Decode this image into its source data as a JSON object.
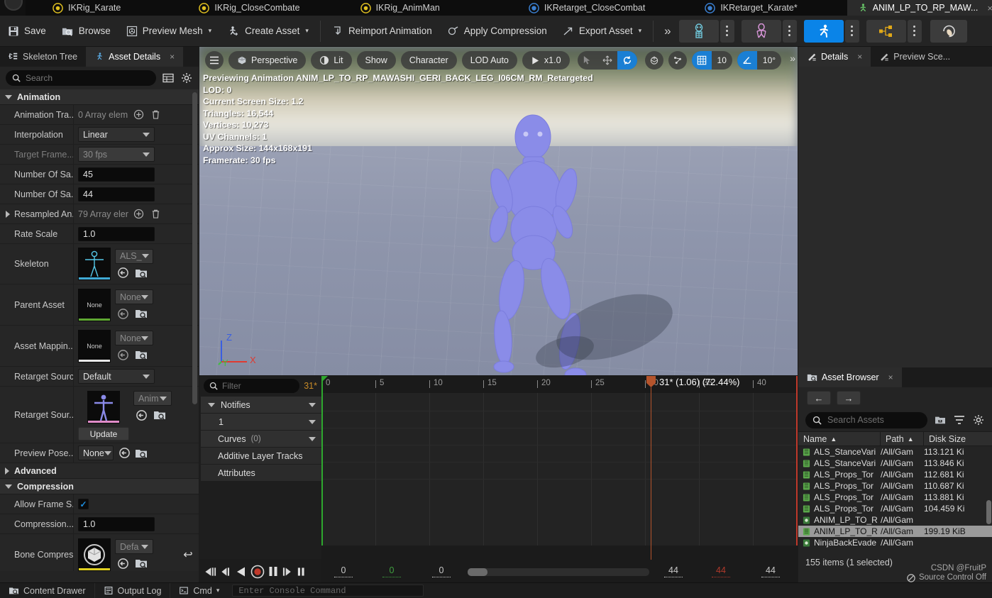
{
  "window": {
    "tabs": [
      {
        "label": "IKRig_Karate",
        "icon": "ikrig-icon",
        "active": false,
        "closable": false
      },
      {
        "label": "IKRig_CloseCombate",
        "icon": "ikrig-icon",
        "active": false,
        "closable": false
      },
      {
        "label": "IKRig_AnimMan",
        "icon": "ikrig-icon",
        "active": false,
        "closable": false
      },
      {
        "label": "IKRetarget_CloseCombat",
        "icon": "ikretarget-icon",
        "active": false,
        "closable": false
      },
      {
        "label": "IKRetarget_Karate*",
        "icon": "ikretarget-icon",
        "active": false,
        "closable": false
      },
      {
        "label": "ANIM_LP_TO_RP_MAW...",
        "icon": "animsequence-icon",
        "active": true,
        "closable": true,
        "close_label": "×"
      }
    ]
  },
  "toolbar": {
    "buttons": [
      {
        "label": "Save",
        "icon": "save-icon",
        "caret": false
      },
      {
        "label": "Browse",
        "icon": "browse-icon",
        "caret": false
      },
      {
        "label": "Preview Mesh",
        "icon": "preview-mesh-icon",
        "caret": true
      },
      {
        "label": "Create Asset",
        "icon": "create-asset-icon",
        "caret": true
      },
      {
        "label": "Reimport Animation",
        "icon": "reimport-icon",
        "caret": false
      },
      {
        "label": "Apply Compression",
        "icon": "compression-icon",
        "caret": false
      },
      {
        "label": "Export Asset",
        "icon": "export-icon",
        "caret": true
      }
    ],
    "overflow_glyph": "»",
    "caret_glyph": "▾",
    "modes": [
      {
        "name": "skeleton-mode",
        "selected": false
      },
      {
        "name": "mesh-mode",
        "selected": false
      },
      {
        "name": "animation-mode",
        "selected": true
      },
      {
        "name": "graph-mode",
        "selected": false
      },
      {
        "name": "physics-mode",
        "selected": false
      }
    ]
  },
  "left_panel": {
    "tabs": [
      {
        "label": "Skeleton Tree",
        "icon": "skeleton-tree-icon",
        "active": false,
        "closable": false
      },
      {
        "label": "Asset Details",
        "icon": "asset-details-icon",
        "active": true,
        "closable": true
      }
    ],
    "close_glyph": "×",
    "search": {
      "placeholder": "Search",
      "value": ""
    },
    "sections": [
      {
        "title": "Animation",
        "expanded": true
      },
      {
        "title": "Advanced",
        "expanded": false
      },
      {
        "title": "Compression",
        "expanded": true
      }
    ],
    "properties": {
      "animation_track_names": {
        "label": "Animation Tra...",
        "value": "0 Array elem"
      },
      "interpolation": {
        "label": "Interpolation",
        "value": "Linear"
      },
      "target_frame_rate": {
        "label": "Target Frame...",
        "value": "30 fps",
        "disabled": true
      },
      "number_of_samples_1": {
        "label": "Number Of Sa...",
        "value": "45"
      },
      "number_of_samples_2": {
        "label": "Number Of Sa...",
        "value": "44"
      },
      "resampled_anim": {
        "label": "Resampled An...",
        "value": "79 Array eler"
      },
      "rate_scale": {
        "label": "Rate Scale",
        "value": "1.0"
      },
      "skeleton": {
        "label": "Skeleton",
        "value": "ALS_",
        "thumb_caption": "",
        "bar_color": "#3fa9d4"
      },
      "parent_asset": {
        "label": "Parent Asset",
        "value": "None",
        "thumb_caption": "None",
        "bar_color": "#5fa832"
      },
      "asset_mapping": {
        "label": "Asset Mappin...",
        "value": "None",
        "thumb_caption": "None",
        "bar_color": "#e8e8e8"
      },
      "retarget_source": {
        "label": "Retarget Source",
        "value": "Default"
      },
      "retarget_source_asset": {
        "label": "Retarget Sour...",
        "value": "Anim",
        "thumb_caption": "",
        "bar_color": "#e08cc8",
        "button": "Update"
      },
      "preview_pose_asset": {
        "label": "Preview Pose...",
        "value": "None"
      },
      "allow_frame_stripping": {
        "label": "Allow Frame S...",
        "checked": true,
        "check_glyph": "✓"
      },
      "compression_error": {
        "label": "Compression...",
        "value": "1.0"
      },
      "bone_compression": {
        "label": "Bone Compres...",
        "value": "Defa",
        "thumb_caption": "",
        "bar_color": "#e0d020"
      }
    },
    "array_add_glyph": "⊕",
    "revert_glyph": "↩"
  },
  "viewport": {
    "chips": {
      "menu": "≡",
      "perspective": "Perspective",
      "lit": "Lit",
      "show": "Show",
      "character": "Character",
      "lod": "LOD Auto",
      "playrate": "x1.0"
    },
    "grid_snap_value": "10",
    "angle_snap_value": "10°",
    "overflow_glyph": "»",
    "stats": [
      "Previewing Animation ANIM_LP_TO_RP_MAWASHI_GERI_BACK_LEG_I06CM_RM_Retargeted",
      "LOD: 0",
      "Current Screen Size: 1.2",
      "Triangles: 16,544",
      "Vertices: 10,273",
      "UV Channels: 1",
      "Approx Size: 144x168x191",
      "Framerate: 30 fps"
    ],
    "gizmo": {
      "x": "X",
      "y": "Y",
      "z": "Z",
      "x_color": "#e03a30",
      "y_color": "#3fc03f",
      "z_color": "#3a5fe0"
    }
  },
  "timeline": {
    "filter": {
      "placeholder": "Filter",
      "value": ""
    },
    "frame_count_badge": "31*",
    "tracks": [
      {
        "label": "Notifies",
        "expandable": true,
        "count": ""
      },
      {
        "label": "1",
        "expandable": true,
        "count": "",
        "indent": true
      },
      {
        "label": "Curves",
        "expandable": true,
        "count": "(0)"
      },
      {
        "label": "Additive Layer Tracks",
        "expandable": false,
        "count": ""
      },
      {
        "label": "Attributes",
        "expandable": false,
        "count": ""
      }
    ],
    "ruler_ticks": [
      "0",
      "5",
      "10",
      "15",
      "20",
      "25",
      "30",
      "35",
      "40"
    ],
    "playhead_label": "31* (1.06) (72.44%)",
    "transport": [
      {
        "name": "step-to-previous-key-button",
        "glyph": "◀|||"
      },
      {
        "name": "step-backward-button",
        "glyph": "◀|"
      },
      {
        "name": "play-reverse-button",
        "glyph": "◀"
      },
      {
        "name": "record-button",
        "glyph": "●"
      },
      {
        "name": "pause-button",
        "glyph": "▐▌"
      },
      {
        "name": "step-forward-button",
        "glyph": "|▶"
      },
      {
        "name": "loop-button",
        "glyph": "▐▌"
      }
    ],
    "numbers": {
      "start_frame": "0",
      "current_frame": "0",
      "in_frame": "0",
      "out_frame": "44",
      "playback_end": "44",
      "total_frames": "44"
    }
  },
  "right_panel": {
    "tabs": [
      {
        "label": "Details",
        "icon": "details-icon",
        "active": true,
        "closable": true
      },
      {
        "label": "Preview Sce...",
        "icon": "preview-scene-icon",
        "active": false,
        "closable": false
      }
    ],
    "close_glyph": "×"
  },
  "asset_browser": {
    "tab": {
      "label": "Asset Browser",
      "icon": "asset-browser-icon",
      "closable": true,
      "close_glyph": "×"
    },
    "nav": {
      "back": "←",
      "forward": "→"
    },
    "search": {
      "placeholder": "Search Assets",
      "value": ""
    },
    "tool_icons": [
      "save-thumbnail-icon",
      "filter-icon",
      "settings-gear-icon"
    ],
    "columns": [
      {
        "label": "Name",
        "sort": "▲"
      },
      {
        "label": "Path",
        "sort": "▲"
      },
      {
        "label": "Disk Size",
        "sort": ""
      }
    ],
    "rows": [
      {
        "name": "ALS_StanceVari",
        "path": "/All/Gam",
        "size": "113.121 Ki",
        "icon_color": "#5aa84a",
        "selected": false
      },
      {
        "name": "ALS_StanceVari",
        "path": "/All/Gam",
        "size": "113.846 Ki",
        "icon_color": "#5aa84a",
        "selected": false
      },
      {
        "name": "ALS_Props_Tor",
        "path": "/All/Gam",
        "size": "112.681 Ki",
        "icon_color": "#5aa84a",
        "selected": false
      },
      {
        "name": "ALS_Props_Tor",
        "path": "/All/Gam",
        "size": "110.687 Ki",
        "icon_color": "#5aa84a",
        "selected": false
      },
      {
        "name": "ALS_Props_Tor",
        "path": "/All/Gam",
        "size": "113.881 Ki",
        "icon_color": "#5aa84a",
        "selected": false
      },
      {
        "name": "ALS_Props_Tor",
        "path": "/All/Gam",
        "size": "104.459 Ki",
        "icon_color": "#5aa84a",
        "selected": false
      },
      {
        "name": "ANIM_LP_TO_R",
        "path": "/All/Gam",
        "size": "",
        "icon_color": "#3a7a3a",
        "selected": false
      },
      {
        "name": "ANIM_LP_TO_R",
        "path": "/All/Gam",
        "size": "199.19 KiB",
        "icon_color": "#5aa84a",
        "selected": true
      },
      {
        "name": "NinjaBackEvade",
        "path": "/All/Gam",
        "size": "",
        "icon_color": "#3a7a3a",
        "selected": false
      }
    ],
    "status": "155 items (1 selected)"
  },
  "status_bar": {
    "items": [
      {
        "label": "Content Drawer",
        "icon": "content-drawer-icon"
      },
      {
        "label": "Output Log",
        "icon": "output-log-icon"
      },
      {
        "label": "Cmd",
        "icon": "cmd-icon",
        "caret": true
      }
    ],
    "console": {
      "placeholder": "Enter Console Command",
      "value": ""
    },
    "source_control": "Source Control Off",
    "watermark": "CSDN @FruitP"
  }
}
